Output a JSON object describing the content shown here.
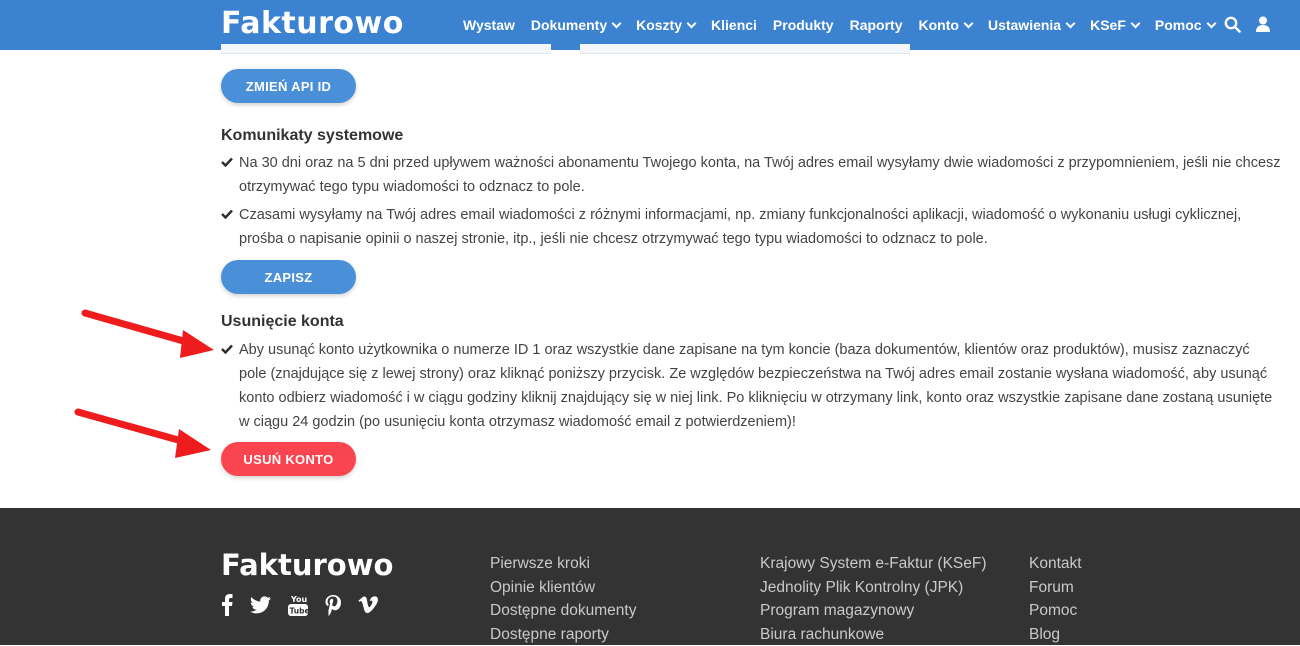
{
  "header": {
    "logo": "Fakturowo",
    "nav": [
      {
        "label": "Wystaw",
        "dropdown": false
      },
      {
        "label": "Dokumenty",
        "dropdown": true
      },
      {
        "label": "Koszty",
        "dropdown": true
      },
      {
        "label": "Klienci",
        "dropdown": false
      },
      {
        "label": "Produkty",
        "dropdown": false
      },
      {
        "label": "Raporty",
        "dropdown": false
      },
      {
        "label": "Konto",
        "dropdown": true
      },
      {
        "label": "Ustawienia",
        "dropdown": true
      },
      {
        "label": "KSeF",
        "dropdown": true
      },
      {
        "label": "Pomoc",
        "dropdown": true
      }
    ],
    "icons": [
      "search-icon",
      "user-icon"
    ]
  },
  "api": {
    "button_label": "ZMIEŃ API ID"
  },
  "system_messages": {
    "title": "Komunikaty systemowe",
    "items": [
      {
        "checked": true,
        "text": "Na 30 dni oraz na 5 dni przed upływem ważności abonamentu Twojego konta, na Twój adres email wysyłamy dwie wiadomości z przypomnieniem, jeśli nie chcesz otrzymywać tego typu wiadomości to odznacz to pole."
      },
      {
        "checked": true,
        "text": "Czasami wysyłamy na Twój adres email wiadomości z różnymi informacjami, np. zmiany funkcjonalności aplikacji, wiadomość o wykonaniu usługi cyklicznej, prośba o napisanie opinii o naszej stronie, itp., jeśli nie chcesz otrzymywać tego typu wiadomości to odznacz to pole."
      }
    ],
    "save_label": "ZAPISZ"
  },
  "delete_account": {
    "title": "Usunięcie konta",
    "checked": true,
    "text": "Aby usunąć konto użytkownika o numerze ID 1 oraz wszystkie dane zapisane na tym koncie (baza dokumentów, klientów oraz produktów), musisz zaznaczyć pole (znajdujące się z lewej strony) oraz kliknąć poniższy przycisk. Ze względów bezpieczeństwa na Twój adres email zostanie wysłana wiadomość, aby usunąć konto odbierz wiadomość i w ciągu godziny kliknij znajdujący się w niej link. Po kliknięciu w otrzymany link, konto oraz wszystkie zapisane dane zostaną usunięte w ciągu 24 godzin (po usunięciu konta otrzymasz wiadomość email z potwierdzeniem)!",
    "button_label": "USUŃ KONTO"
  },
  "footer": {
    "logo": "Fakturowo",
    "social": [
      "facebook-icon",
      "twitter-icon",
      "youtube-icon",
      "pinterest-icon",
      "vimeo-icon"
    ],
    "columns": [
      [
        "Pierwsze kroki",
        "Opinie klientów",
        "Dostępne dokumenty",
        "Dostępne raporty"
      ],
      [
        "Krajowy System e-Faktur (KSeF)",
        "Jednolity Plik Kontrolny (JPK)",
        "Program magazynowy",
        "Biura rachunkowe"
      ],
      [
        "Kontakt",
        "Forum",
        "Pomoc",
        "Blog"
      ]
    ]
  },
  "colors": {
    "header_bg": "#3b82d0",
    "primary_button": "#4a90d9",
    "danger_button": "#fa4450",
    "footer_bg": "#333333",
    "annotation_arrow": "#ee1c1c"
  }
}
